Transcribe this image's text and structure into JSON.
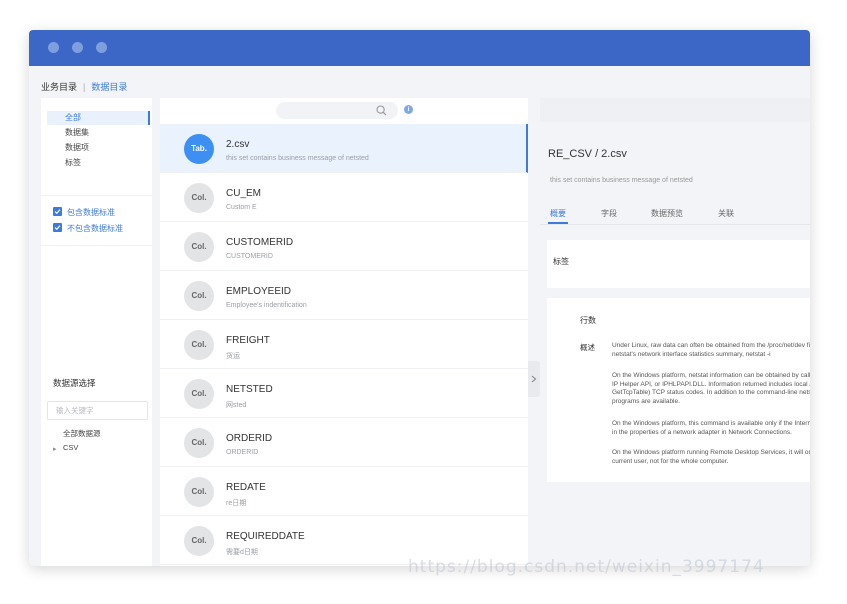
{
  "breadcrumb": {
    "business": "业务目录",
    "data": "数据目录"
  },
  "categories": [
    {
      "label": "全部",
      "active": true
    },
    {
      "label": "数据集"
    },
    {
      "label": "数据项"
    },
    {
      "label": "标签"
    }
  ],
  "filters": [
    {
      "label": "包含数据标准",
      "checked": true
    },
    {
      "label": "不包含数据标准",
      "checked": true
    }
  ],
  "datasource": {
    "title": "数据源选择",
    "placeholder": "输入关键字",
    "all_label": "全部数据源",
    "csv_label": "CSV"
  },
  "list": [
    {
      "badge": "Tab.",
      "title": "2.csv",
      "desc": "this set contains business message of netsted",
      "selected": true
    },
    {
      "badge": "Col.",
      "title": "CU_EM",
      "desc": "Custom E"
    },
    {
      "badge": "Col.",
      "title": "CUSTOMERID",
      "desc": "CUSTOMERID"
    },
    {
      "badge": "Col.",
      "title": "EMPLOYEEID",
      "desc": "Employee's indentification"
    },
    {
      "badge": "Col.",
      "title": "FREIGHT",
      "desc": "货运"
    },
    {
      "badge": "Col.",
      "title": "NETSTED",
      "desc": "网sted"
    },
    {
      "badge": "Col.",
      "title": "ORDERID",
      "desc": "ORDERID"
    },
    {
      "badge": "Col.",
      "title": "REDATE",
      "desc": "re日期"
    },
    {
      "badge": "Col.",
      "title": "REQUIREDDATE",
      "desc": "需要d日期"
    }
  ],
  "detail": {
    "title": "RE_CSV / 2.csv",
    "desc": "this set contains business message of netsted",
    "tabs": [
      "概要",
      "字段",
      "数据预览",
      "关联"
    ],
    "tag_label": "标签",
    "rows_label": "行数",
    "overview_label": "概述",
    "paragraphs": [
      [
        "Under Linux, raw data can often be obtained from the /proc/net/dev file and summarized into",
        "netstat's network interface statistics summary, netstat -i"
      ],
      [
        "On the Windows platform, netstat information can be obtained by calling the GetTcpTable",
        "IP Helper API, or IPHLPAPI.DLL. Information returned includes local and remote IP addresses,",
        "GetTcpTable) TCP status codes. In addition to the command-line netstat.exe tool that comes with",
        "programs are available."
      ],
      [
        "On the Windows platform, this command is available only if the Internet Protocol (TCP/IP) protocol is installed",
        "in the properties of a network adapter in Network Connections."
      ],
      [
        "On the Windows platform running Remote Desktop Services, it will only show connections for the",
        "current user, not for the whole computer."
      ]
    ]
  },
  "watermark": "https://blog.csdn.net/weixin_3997174",
  "colors": {
    "titlebar": "#3d67c6",
    "accent": "#3d7bd9",
    "avatar_selected": "#3d8ff2"
  }
}
